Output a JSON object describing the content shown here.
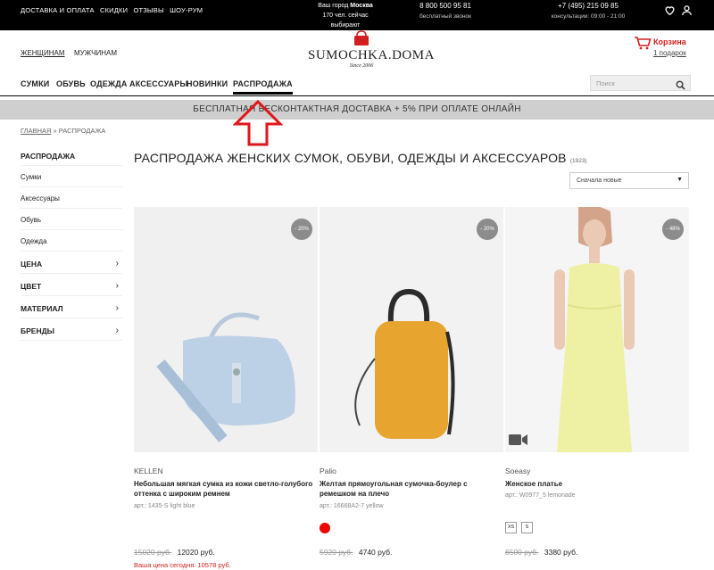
{
  "topbar": {
    "links": [
      "ДОСТАВКА И ОПЛАТА",
      "СКИДКИ",
      "ОТЗЫВЫ",
      "ШОУ-РУМ"
    ],
    "city_label": "Ваш город",
    "city": "Москва",
    "viewers": "170 чел. сейчас выбирают",
    "phone1": "8 800 500 95 81",
    "phone1_note": "бесплатный звонок",
    "phone2": "+7 (495) 215 09 85",
    "phone2_note": "консультации: 09:00 - 21:00"
  },
  "header": {
    "women": "ЖЕНЩИНАМ",
    "men": "МУЖЧИНАМ",
    "logo_name": "SUMOCHKA.DOMA",
    "logo_since": "Since 2006",
    "cart_label": "Корзина",
    "cart_count": "1 подарок"
  },
  "nav": {
    "items": [
      "СУМКИ",
      "ОБУВЬ",
      "ОДЕЖДА",
      "АКСЕССУАРЫ",
      "НОВИНКИ",
      "РАСПРОДАЖА"
    ],
    "search_placeholder": "Поиск"
  },
  "promo": "БЕСПЛАТНАЯ БЕСКОНТАКТНАЯ ДОСТАВКА + 5% ПРИ ОПЛАТЕ ОНЛАЙН",
  "breadcrumb": {
    "home": "ГЛАВНАЯ",
    "sep": "»",
    "current": "РАСПРОДАЖА"
  },
  "sidebar": {
    "head": "РАСПРОДАЖА",
    "items": [
      "Сумки",
      "Аксессуары",
      "Обувь",
      "Одежда"
    ],
    "filters": [
      "ЦЕНА",
      "ЦВЕТ",
      "МАТЕРИАЛ",
      "БРЕНДЫ"
    ]
  },
  "main": {
    "title": "РАСПРОДАЖА ЖЕНСКИХ СУМОК, ОБУВИ, ОДЕЖДЫ И АКСЕССУАРОВ",
    "count": "(1923)",
    "sort": "Сначала новые"
  },
  "products": [
    {
      "discount": "- 20%",
      "brand": "KELLEN",
      "name": "Небольшая мягкая сумка из кожи светло-голубого оттенка с широким ремнем",
      "art": "арт.: 1435-S light blue",
      "old_price": "15020 руб.",
      "price": "12020 руб.",
      "today": "Ваша цена сегодня: 10578 руб."
    },
    {
      "discount": "- 20%",
      "brand": "Palio",
      "name": "Желтая прямоугольная сумочка-боулер с ремешком на плечо",
      "art": "арт.: 16668A2-7 yellow",
      "old_price": "5920 руб.",
      "price": "4740 руб."
    },
    {
      "discount": "- 48%",
      "brand": "Soeasy",
      "name": "Женское платье",
      "art": "арт.: W0977_5 lemonade",
      "sizes": [
        "XS",
        "S"
      ],
      "old_price": "6500 руб.",
      "price": "3380 руб."
    }
  ],
  "colors": {
    "accent": "#d21f1f",
    "promo_bg": "#cfcfcf",
    "badge": "#8c8c8c"
  }
}
